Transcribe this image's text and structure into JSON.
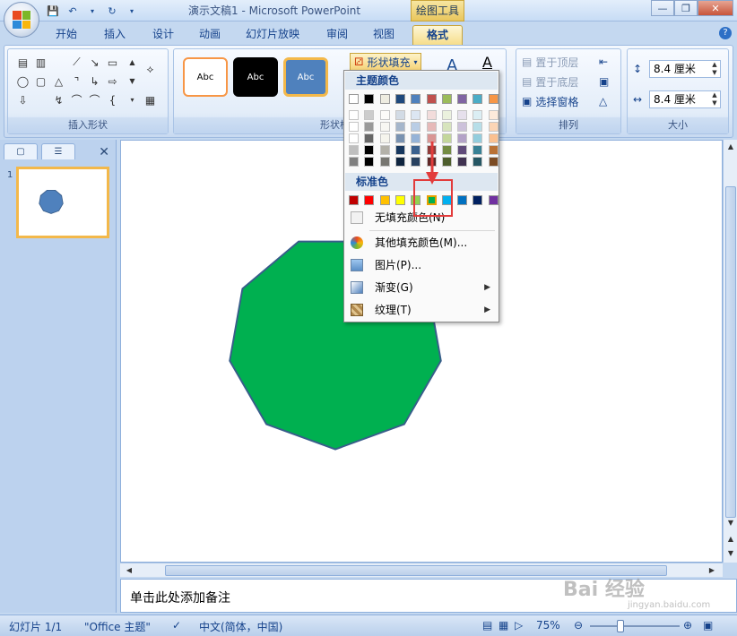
{
  "window": {
    "title": "演示文稿1 - Microsoft PowerPoint",
    "context_tab_group": "绘图工具"
  },
  "ribbon": {
    "tabs": [
      "开始",
      "插入",
      "设计",
      "动画",
      "幻灯片放映",
      "审阅",
      "视图",
      "格式"
    ],
    "active_tab": "格式",
    "groups": {
      "insert_shapes": "插入形状",
      "shape_styles": "形状样式",
      "arrange": "排列",
      "size": "大小"
    },
    "style_presets": [
      "Abc",
      "Abc",
      "Abc"
    ],
    "shape_fill_label": "形状填充",
    "bring_to_front": "置于顶层",
    "send_to_back": "置于底层",
    "selection_pane": "选择窗格",
    "height_value": "8.4 厘米",
    "width_value": "8.4 厘米"
  },
  "fill_menu": {
    "theme_colors_header": "主题颜色",
    "standard_colors_header": "标准色",
    "no_fill": "无填充颜色(N)",
    "more_colors": "其他填充颜色(M)...",
    "picture": "图片(P)...",
    "gradient": "渐变(G)",
    "texture": "纹理(T)",
    "theme_top_row": [
      "#ffffff",
      "#000000",
      "#eeece1",
      "#1f497d",
      "#4f81bd",
      "#c0504d",
      "#9bbb59",
      "#8064a2",
      "#4bacc6",
      "#f79646"
    ],
    "standard_colors": [
      "#c00000",
      "#ff0000",
      "#ffc000",
      "#ffff00",
      "#92d050",
      "#00b050",
      "#00b0f0",
      "#0070c0",
      "#002060",
      "#7030a0"
    ],
    "selected_standard_index": 5
  },
  "slides_pane": {
    "slide_number": "1"
  },
  "slide": {
    "shape": "nonagon",
    "fill_color": "#00b050",
    "thumbnail_fill": "#4f81bd"
  },
  "notes": {
    "placeholder": "单击此处添加备注"
  },
  "status": {
    "slide_indicator": "幻灯片 1/1",
    "theme": "\"Office 主题\"",
    "language": "中文(简体，中国)",
    "zoom": "75%"
  },
  "watermark": "Bai 经验",
  "watermark_sub": "jingyan.baidu.com"
}
